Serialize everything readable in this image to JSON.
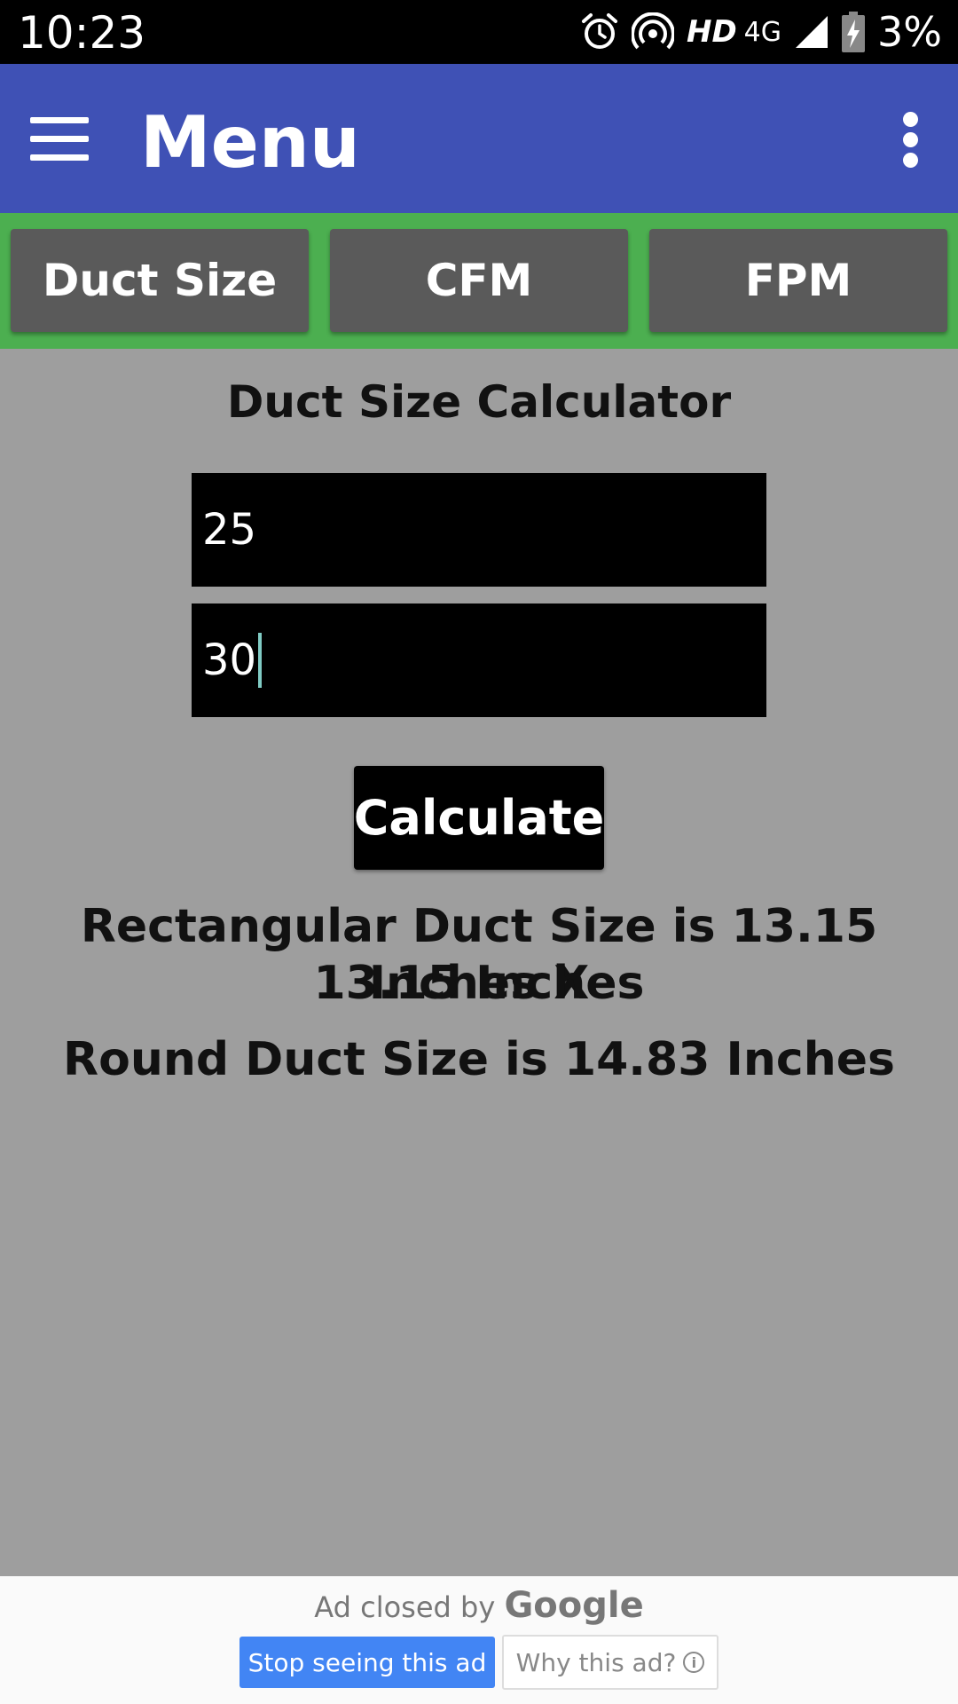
{
  "status_bar": {
    "time": "10:23",
    "hd_label": "HD",
    "network_label": "4G",
    "battery_percent": "3%",
    "icons": [
      "alarm-icon",
      "hotspot-icon",
      "signal-icon",
      "battery-charging-icon"
    ]
  },
  "app_bar": {
    "title": "Menu",
    "color": "#3f51b5"
  },
  "tabs": [
    {
      "label": "Duct Size"
    },
    {
      "label": "CFM"
    },
    {
      "label": "FPM"
    }
  ],
  "tab_strip_color": "#4caf50",
  "calculator": {
    "title": "Duct Size Calculator",
    "input1_value": "25",
    "input2_value": "30",
    "calculate_label": "Calculate",
    "result_rect_line1": "Rectangular Duct Size is 13.15 Inches X",
    "result_rect_line2": "13.15 Inches",
    "result_round": "Round Duct Size is 14.83 Inches"
  },
  "ad": {
    "closed_text": "Ad closed by",
    "brand": "Google",
    "stop_label": "Stop seeing this ad",
    "why_label": "Why this ad?"
  }
}
